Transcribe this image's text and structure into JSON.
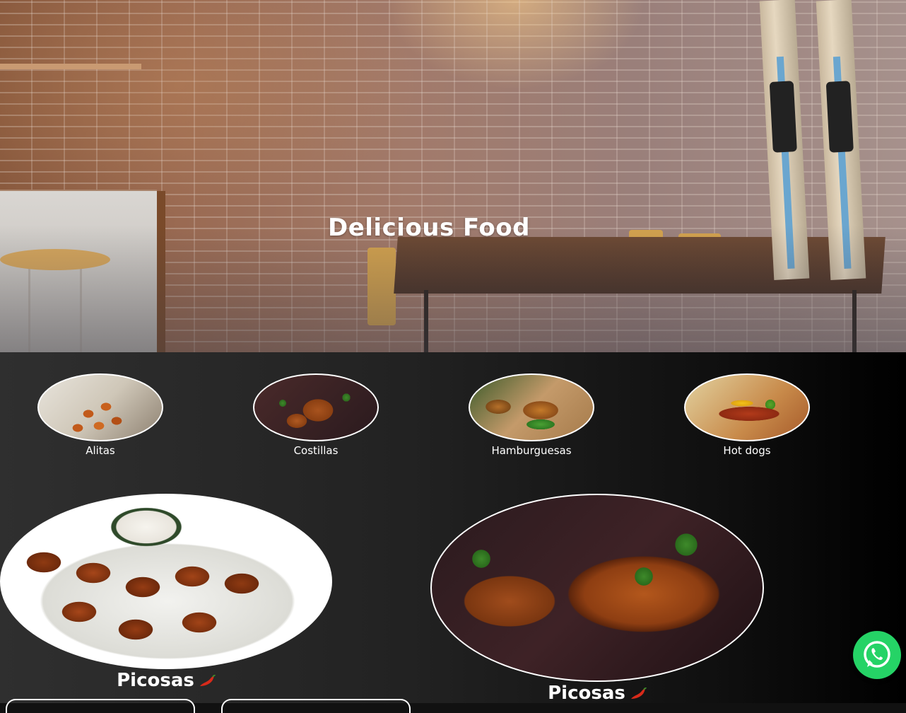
{
  "hero": {
    "title": "Delicious Food"
  },
  "categories": [
    {
      "label": "Alitas",
      "icon": "wings-photo"
    },
    {
      "label": "Costillas",
      "icon": "ribs-photo"
    },
    {
      "label": "Hamburguesas",
      "icon": "burgers-photo"
    },
    {
      "label": "Hot dogs",
      "icon": "hotdogs-photo"
    }
  ],
  "featured": [
    {
      "label": "Picosas",
      "icon": "chili-pepper-icon"
    },
    {
      "label": "Picosas",
      "icon": "chili-pepper-icon"
    }
  ],
  "floating": {
    "icon": "whatsapp-icon",
    "color": "#25d366"
  },
  "colors": {
    "background_dark": "#111111",
    "text": "#ffffff",
    "chili": "#d82a1a"
  }
}
